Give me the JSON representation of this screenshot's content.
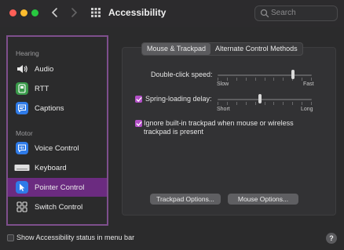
{
  "window": {
    "title": "Accessibility",
    "search_placeholder": "Search"
  },
  "sidebar": {
    "sections": [
      {
        "label": "Hearing"
      },
      {
        "label": "Motor"
      }
    ],
    "items": [
      {
        "label": "Audio"
      },
      {
        "label": "RTT"
      },
      {
        "label": "Captions"
      },
      {
        "label": "Voice Control"
      },
      {
        "label": "Keyboard"
      },
      {
        "label": "Pointer Control",
        "selected": true
      },
      {
        "label": "Switch Control"
      }
    ]
  },
  "tabs": [
    {
      "label": "Mouse & Trackpad",
      "active": true
    },
    {
      "label": "Alternate Control Methods",
      "active": false
    }
  ],
  "settings": {
    "double_click": {
      "label": "Double-click speed:",
      "min_label": "Slow",
      "max_label": "Fast",
      "value": 0.8
    },
    "spring_loading": {
      "label": "Spring-loading delay:",
      "checked": true,
      "min_label": "Short",
      "max_label": "Long",
      "value": 0.45
    },
    "ignore_trackpad": {
      "label_line1": "Ignore built-in trackpad when mouse or wireless",
      "label_line2": "trackpad is present",
      "checked": true
    }
  },
  "buttons": {
    "trackpad_options": "Trackpad Options...",
    "mouse_options": "Mouse Options..."
  },
  "footer": {
    "status_label": "Show Accessibility status in menu bar",
    "status_checked": false,
    "help": "?"
  },
  "colors": {
    "accent": "#b450c8",
    "selection": "#6b2b80",
    "sidebar_border": "#7e4f8c"
  }
}
